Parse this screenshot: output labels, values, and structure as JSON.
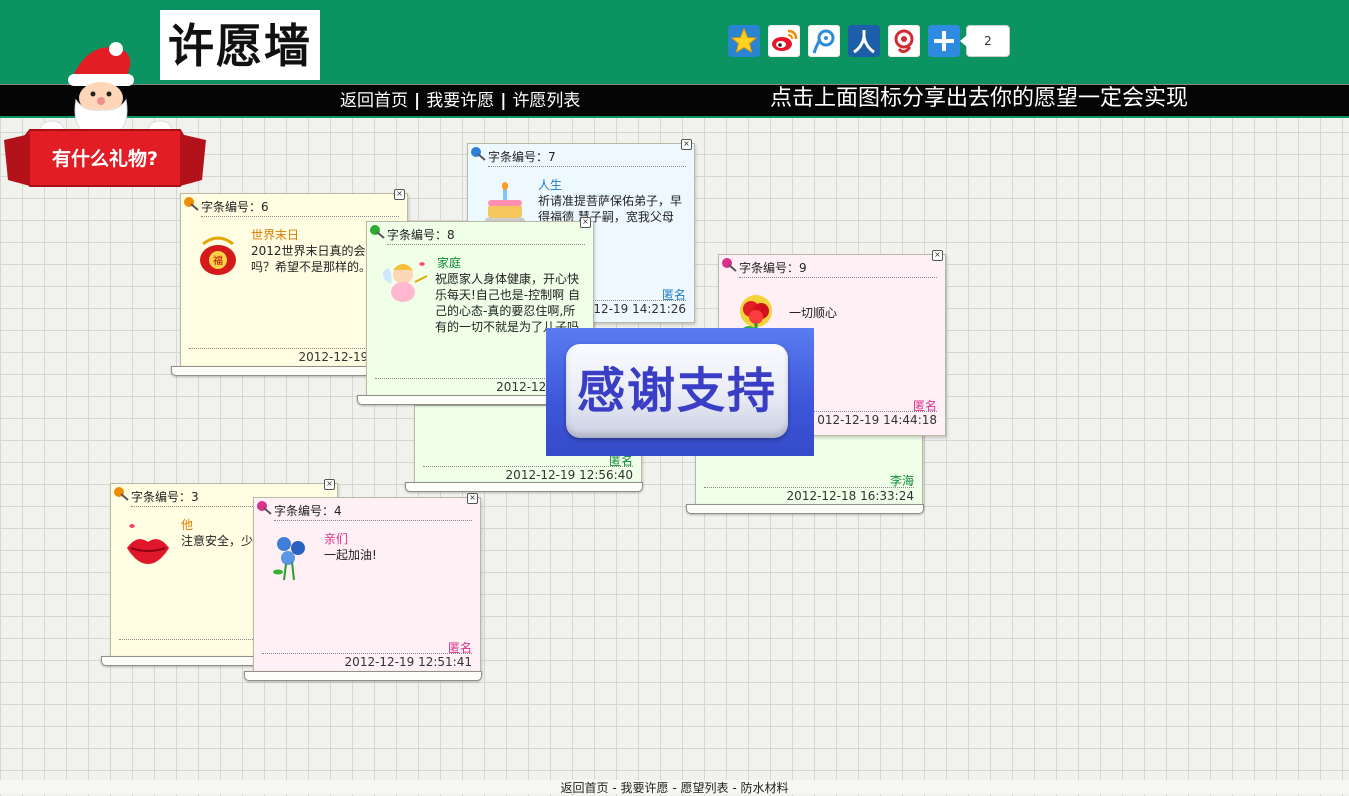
{
  "header": {
    "logo_text": "许愿墙",
    "share_count": "2",
    "share_icons": [
      {
        "name": "qzone-icon",
        "color": "#1b77c8"
      },
      {
        "name": "weibo-icon",
        "color": "#e6162d"
      },
      {
        "name": "tencent-weibo-icon",
        "color": "#2c8bd6"
      },
      {
        "name": "renren-icon",
        "color": "#1c5ea8"
      },
      {
        "name": "kaixin-icon",
        "color": "#d12b33"
      },
      {
        "name": "more-share-icon",
        "color": "#2f8be0"
      }
    ]
  },
  "nav": {
    "home": "返回首页",
    "wish": "我要许愿",
    "list": "许愿列表",
    "sep": "|",
    "slogan": "点击上面图标分享出去你的愿望一定会实现"
  },
  "santa": {
    "banner_text": "有什么礼物?"
  },
  "thanks": {
    "text": "感谢支持"
  },
  "colors": {
    "header_green": "#0b9462",
    "note_yellow": "#fffee2",
    "note_blue": "#eef8ff",
    "note_green": "#efffe8",
    "note_pink": "#fff0f6"
  },
  "notes": {
    "n2": {
      "sign": "匿名",
      "time": "2012-12-19 12:56:40"
    },
    "n1": {
      "sign": "李海",
      "time": "2012-12-18 16:33:24"
    },
    "n7": {
      "head": "字条编号：7",
      "title": "人生",
      "content": "祈请准提菩萨保佑弟子，早得福德   慧子嗣，宽我父母",
      "sign": "匿名",
      "time": "2012-12-19 14:21:26",
      "time_shown": "12-19 14:21:26"
    },
    "n9": {
      "head": "字条编号：9",
      "title": "",
      "content": "一切顺心",
      "sign": "匿名",
      "time": "2012-12-19 14:44:18",
      "time_shown": "012-12-19 14:44:18"
    },
    "n6": {
      "head": "字条编号：6",
      "title": "世界末日",
      "content": "2012世界末日真的会来吗？希望不是那样的。",
      "time": "2012-12-19 13:0",
      "time_shown": "2012-12-19 13:0"
    },
    "n8": {
      "head": "字条编号：8",
      "title": "家庭",
      "content": "祝愿家人身体健康，开心快乐每天!自己也是-控制啊 自己的心态-真的要忍住啊,所有的一切不就是为了儿子吗",
      "time": "2012-12-19 14",
      "time_shown": "2012-12-19 14"
    },
    "n3": {
      "head": "字条编号：3",
      "title": "他",
      "content": "注意安全，少",
      "time": "2012-12-",
      "time_shown": "2012-12-"
    },
    "n4": {
      "head": "字条编号：4",
      "title": "亲们",
      "content": "一起加油!",
      "sign": "匿名",
      "time": "2012-12-19 12:51:41"
    }
  },
  "footer": {
    "home": "返回首页",
    "wish": "我要许愿",
    "list": "愿望列表",
    "ad": "防水材料",
    "sep": " - "
  }
}
